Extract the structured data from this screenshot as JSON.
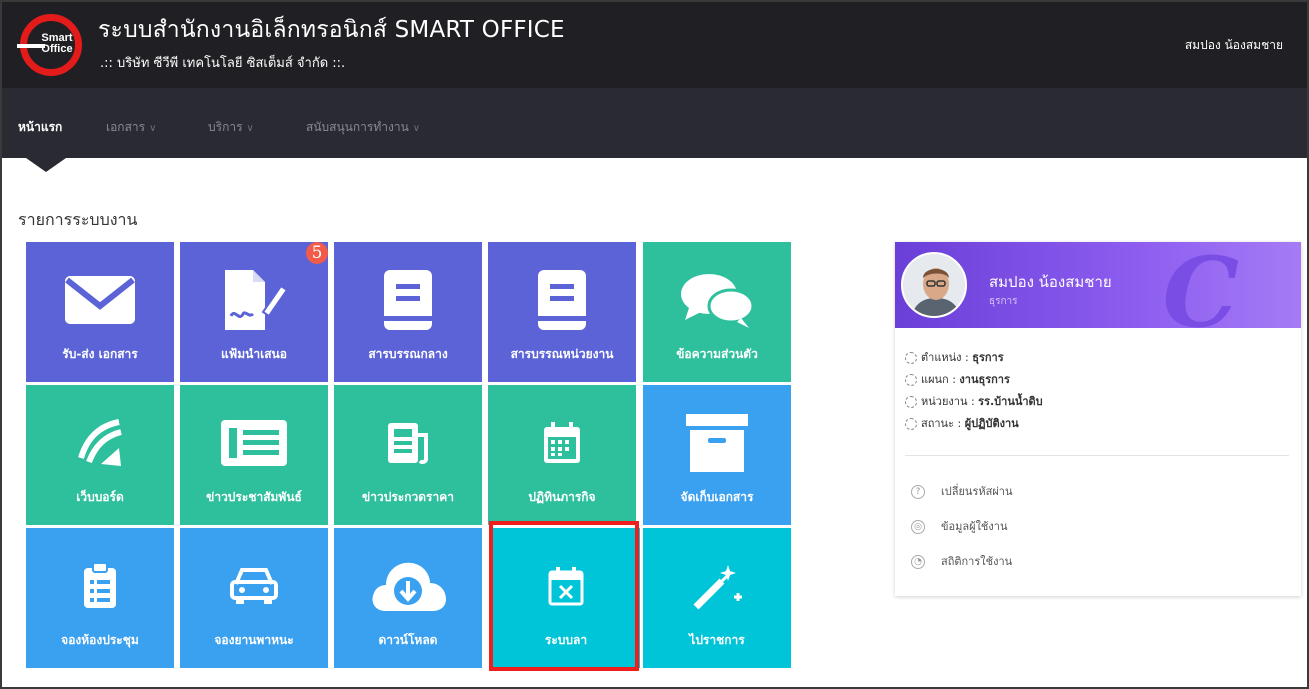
{
  "header": {
    "logo_line1": "Smart",
    "logo_line2": "Office",
    "title": "ระบบสำนักงานอิเล็กทรอนิกส์ SMART OFFICE",
    "subtitle": ".:: บริษัท ซีวีพี เทคโนโลยี ซิสเต็มส์ จำกัด ::.",
    "user": "สมปอง น้องสมชาย"
  },
  "nav": {
    "items": [
      {
        "label": "หน้าแรก",
        "active": true
      },
      {
        "label": "เอกสาร",
        "active": false
      },
      {
        "label": "บริการ",
        "active": false
      },
      {
        "label": "สนับสนุนการทำงาน",
        "active": false
      }
    ],
    "chevron": "∨"
  },
  "main": {
    "section_title": "รายการระบบงาน",
    "badge_count": "5",
    "tiles": [
      {
        "label": "รับ-ส่ง เอกสาร",
        "icon": "envelope-icon",
        "color": "#5b63d6"
      },
      {
        "label": "แฟ้มนำเสนอ",
        "icon": "signature-icon",
        "color": "#5b63d6"
      },
      {
        "label": "สารบรรณกลาง",
        "icon": "book-icon",
        "color": "#5b63d6"
      },
      {
        "label": "สารบรรณหน่วยงาน",
        "icon": "book-icon",
        "color": "#5b63d6"
      },
      {
        "label": "ข้อความส่วนตัว",
        "icon": "chat-bubbles-icon",
        "color": "#2ebf9d"
      },
      {
        "label": "เว็บบอร์ด",
        "icon": "webboard-icon",
        "color": "#2ebf9d"
      },
      {
        "label": "ข่าวประชาสัมพันธ์",
        "icon": "news-list-icon",
        "color": "#2ebf9d"
      },
      {
        "label": "ข่าวประกวดราคา",
        "icon": "newspaper-icon",
        "color": "#2ebf9d"
      },
      {
        "label": "ปฏิทินภารกิจ",
        "icon": "calendar-icon",
        "color": "#2ebf9d"
      },
      {
        "label": "จัดเก็บเอกสาร",
        "icon": "archive-box-icon",
        "color": "#3aa0f0"
      },
      {
        "label": "จองห้องประชุม",
        "icon": "clipboard-list-icon",
        "color": "#3aa0f0"
      },
      {
        "label": "จองยานพาหนะ",
        "icon": "car-icon",
        "color": "#3aa0f0"
      },
      {
        "label": "ดาวน์โหลด",
        "icon": "cloud-download-icon",
        "color": "#3aa0f0"
      },
      {
        "label": "ระบบลา",
        "icon": "calendar-x-icon",
        "color": "#00c4d8"
      },
      {
        "label": "ไปราชการ",
        "icon": "magic-wand-icon",
        "color": "#00c4d8"
      }
    ]
  },
  "profile": {
    "name": "สมปอง น้องสมชาย",
    "role": "ธุรการ",
    "position_label": "ตำแหน่ง : ",
    "position_value": "ธุรการ",
    "dept_label": "แผนก : ",
    "dept_value": "งานธุรการ",
    "unit_label": "หน่วยงาน : ",
    "unit_value": "รร.บ้านน้ำดิบ",
    "status_label": "สถานะ : ",
    "status_value": "ผู้ปฏิบัติงาน",
    "actions": [
      {
        "label": "เปลี่ยนรหัสผ่าน",
        "icon": "question-circle-icon"
      },
      {
        "label": "ข้อมูลผู้ใช้งาน",
        "icon": "life-ring-icon"
      },
      {
        "label": "สถิติการใช้งาน",
        "icon": "gauge-icon"
      }
    ]
  }
}
